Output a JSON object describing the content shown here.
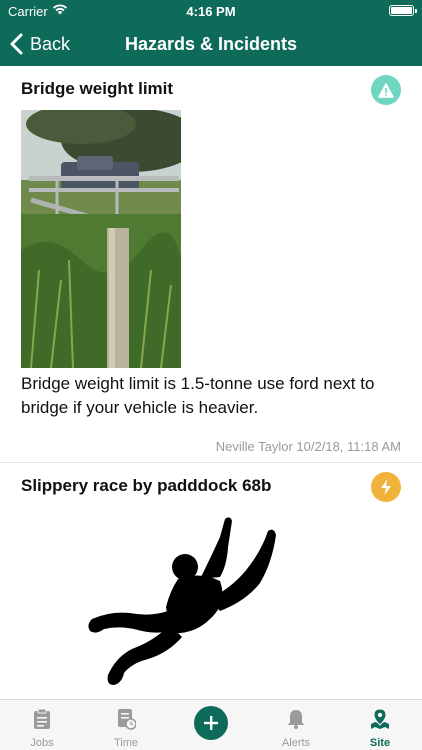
{
  "status_bar": {
    "carrier": "Carrier",
    "time": "4:16 PM"
  },
  "nav": {
    "back_label": "Back",
    "title": "Hazards & Incidents"
  },
  "items": [
    {
      "title": "Bridge weight limit",
      "type_icon": "warning-icon",
      "badge_color": "#6fd6c0",
      "description": "Bridge weight limit is 1.5-tonne use ford next to bridge if your vehicle is heavier.",
      "meta": "Neville Taylor 10/2/18, 11:18 AM"
    },
    {
      "title": "Slippery race by padddock 68b",
      "type_icon": "lightning-icon",
      "badge_color": "#f0b23a"
    }
  ],
  "tabbar": {
    "tabs": [
      {
        "label": "Jobs",
        "icon": "clipboard-icon"
      },
      {
        "label": "Time",
        "icon": "timesheet-icon"
      },
      {
        "label": "Alerts",
        "icon": "bell-icon"
      },
      {
        "label": "Site",
        "icon": "map-pin-icon"
      }
    ],
    "active_tab": "Site",
    "add_icon": "plus-icon"
  },
  "colors": {
    "primary": "#0e6b5a",
    "hazard": "#6fd6c0",
    "incident": "#f0b23a"
  }
}
